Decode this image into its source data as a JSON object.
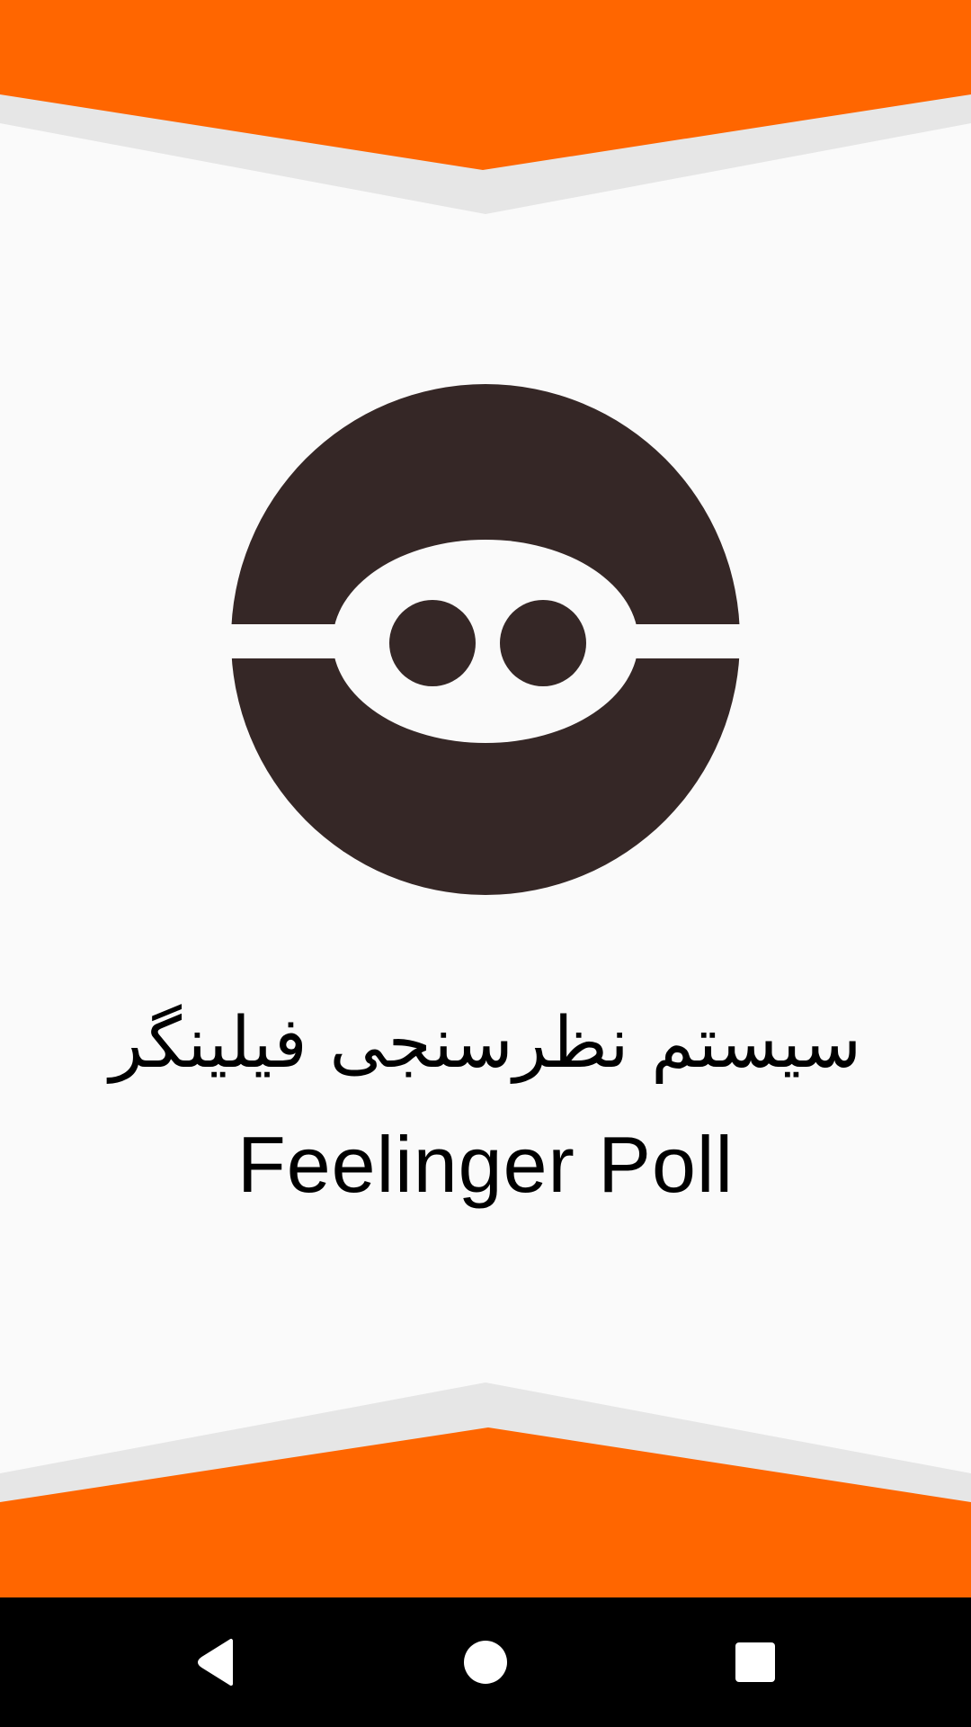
{
  "app": {
    "title_fa": "سیستم نظرسنجی فیلینگر",
    "title_en": "Feelinger Poll"
  },
  "logo": {
    "icon": "feelinger-logo-icon"
  },
  "navigation_bar": {
    "back_icon": "back-triangle-icon",
    "home_icon": "home-circle-icon",
    "recents_icon": "recents-square-icon"
  },
  "colors": {
    "accent_orange": "#FF6600",
    "chevron_gray": "#E6E6E6",
    "background": "#FAFAFA",
    "logo_dark": "#352726",
    "navbar": "#000000"
  }
}
